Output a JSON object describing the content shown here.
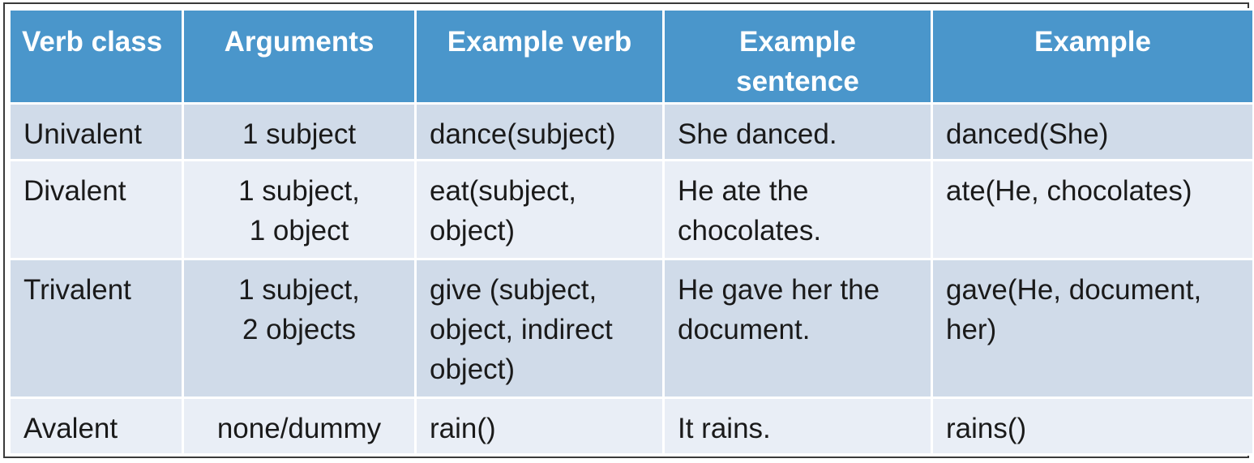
{
  "table": {
    "headers": [
      [
        "Verb class"
      ],
      [
        "Arguments"
      ],
      [
        "Example verb"
      ],
      [
        "Example",
        "sentence"
      ],
      [
        "Example"
      ]
    ],
    "rows": [
      {
        "verb_class": [
          "Univalent"
        ],
        "arguments": [
          "1 subject"
        ],
        "example_verb": [
          "dance(subject)"
        ],
        "example_sentence": [
          "She danced."
        ],
        "example": [
          "danced(She)"
        ]
      },
      {
        "verb_class": [
          "Divalent"
        ],
        "arguments": [
          "1 subject,",
          "1 object"
        ],
        "example_verb": [
          "eat(subject,",
          "object)"
        ],
        "example_sentence": [
          "He ate the",
          "chocolates."
        ],
        "example": [
          "ate(He, chocolates)"
        ]
      },
      {
        "verb_class": [
          "Trivalent"
        ],
        "arguments": [
          "1 subject,",
          "2 objects"
        ],
        "example_verb": [
          "give (subject,",
          "object, indirect",
          "object)"
        ],
        "example_sentence": [
          "He gave her the",
          "document."
        ],
        "example": [
          "gave(He, document,",
          "her)"
        ]
      },
      {
        "verb_class": [
          "Avalent"
        ],
        "arguments": [
          "none/dummy"
        ],
        "example_verb": [
          "rain()"
        ],
        "example_sentence": [
          "It rains."
        ],
        "example": [
          "rains()"
        ]
      }
    ]
  },
  "colors": {
    "header_bg": "#4a96cb",
    "header_text": "#ffffff",
    "row_odd_bg": "#d0dbe9",
    "row_even_bg": "#e9eef6",
    "frame_border": "#3a3a3a"
  }
}
